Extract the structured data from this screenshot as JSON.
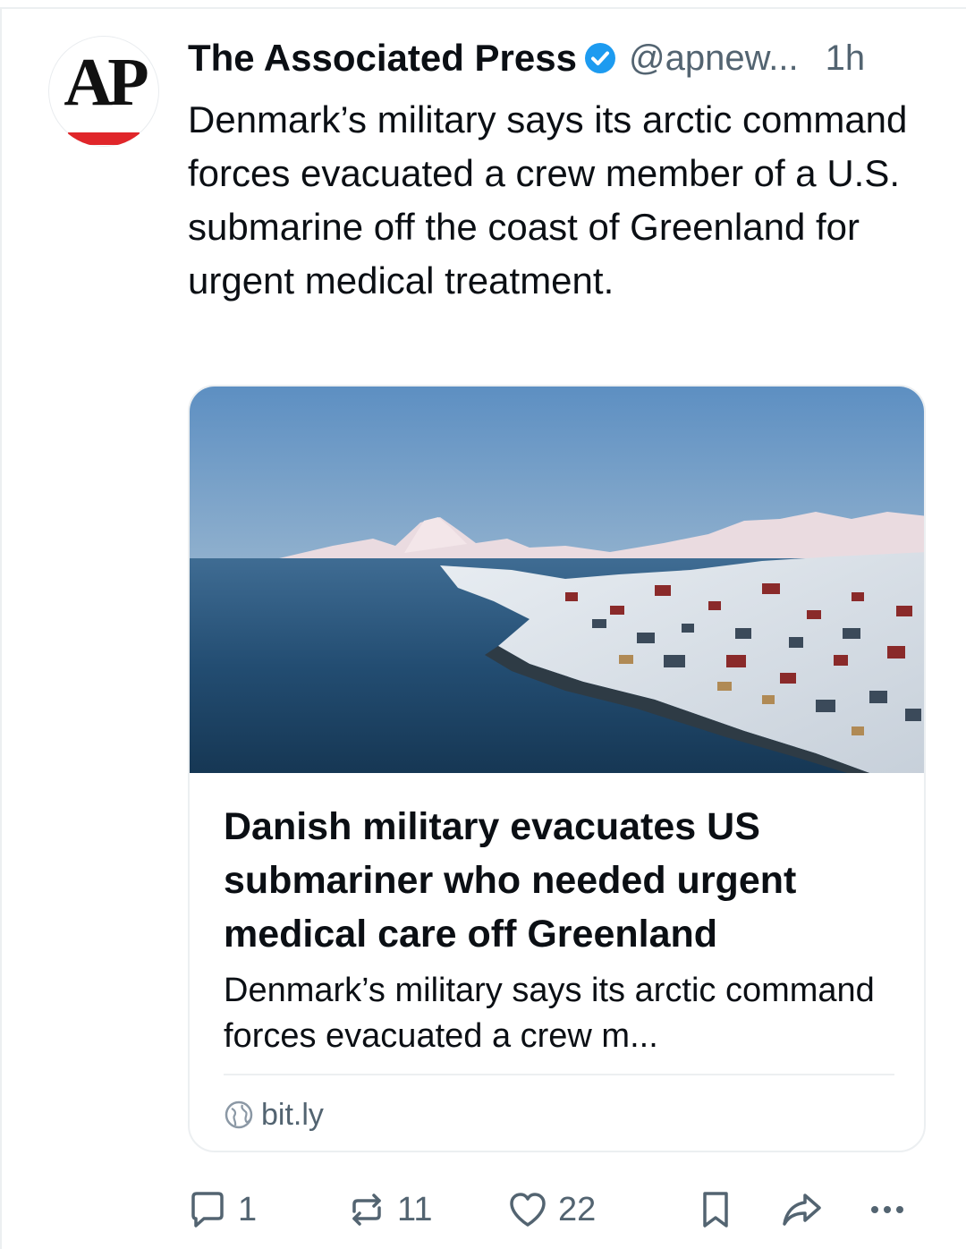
{
  "account": {
    "avatar_text": "AP",
    "name": "The Associated Press",
    "verified": true,
    "handle": "@apnew...",
    "time": "1h"
  },
  "post": {
    "text": "Denmark’s military says its arctic command forces evacuated a crew member of a U.S. submarine off the coast of Greenland for urgent medical treatment."
  },
  "link_card": {
    "title": "Danish military evacuates US submariner who needed urgent medical care off Greenland",
    "description": "Denmark’s military says its arctic command forces evacuated a crew m...",
    "domain": "bit.ly"
  },
  "actions": {
    "replies": "1",
    "reposts": "11",
    "likes": "22"
  },
  "icons": {
    "verified": "verified-badge-icon",
    "globe": "globe-icon",
    "reply": "reply-icon",
    "repost": "repost-icon",
    "like": "heart-icon",
    "bookmark": "bookmark-icon",
    "share": "share-icon",
    "more": "more-dots-icon"
  },
  "colors": {
    "accent": "#1d9bf0",
    "muted": "#536471",
    "ap_red": "#e0262a"
  }
}
